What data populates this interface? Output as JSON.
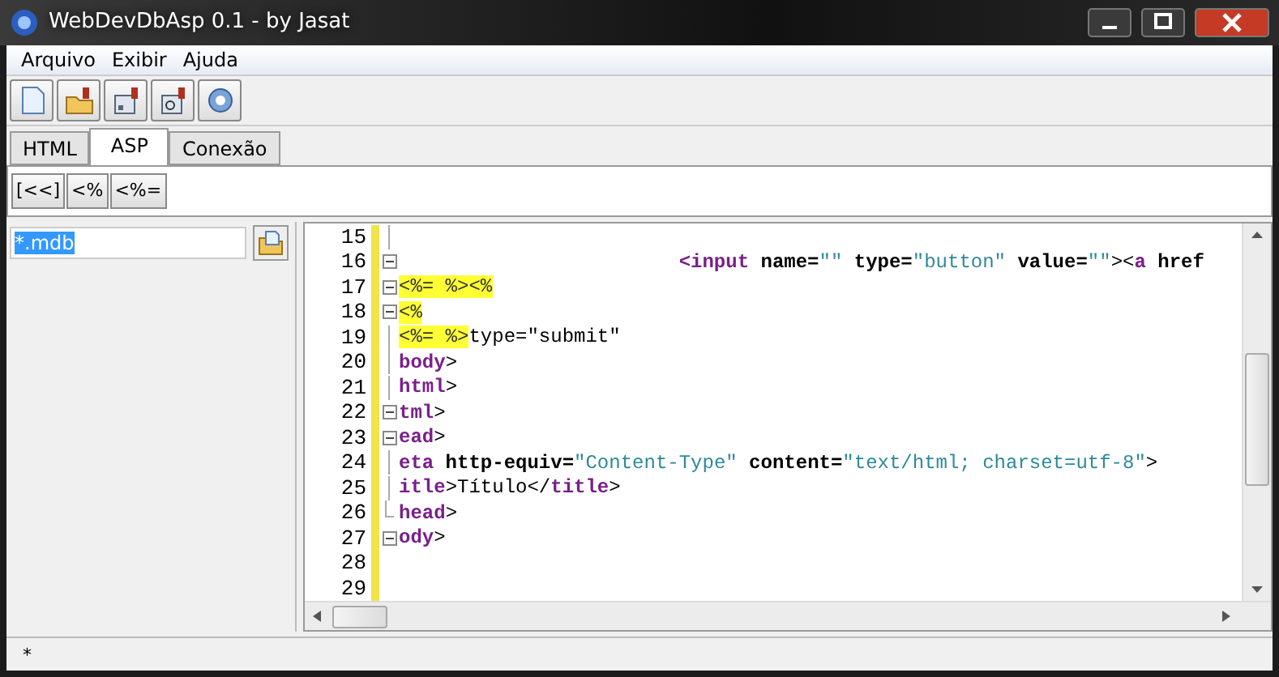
{
  "window": {
    "title": "WebDevDbAsp 0.1 - by Jasat"
  },
  "menu": [
    "Arquivo",
    "Exibir",
    "Ajuda"
  ],
  "toolbar": [
    {
      "kind": "new"
    },
    {
      "kind": "open"
    },
    {
      "kind": "save"
    },
    {
      "kind": "query"
    },
    {
      "kind": "help"
    }
  ],
  "tabs": [
    {
      "label": "HTML",
      "selected": false
    },
    {
      "label": "ASP",
      "selected": true
    },
    {
      "label": "Conexão",
      "selected": false
    }
  ],
  "snippet_buttons": [
    "[<<]",
    "<%",
    "<%="
  ],
  "file_filter": {
    "value": "*.mdb"
  },
  "editor": {
    "lines": [
      {
        "number": "15",
        "kind": "bar"
      },
      {
        "number": "16",
        "kind": "box",
        "tokens": [
          {
            "kind": "tag",
            "text": "                        <input"
          },
          {
            "kind": "attr",
            "text": " name="
          },
          {
            "kind": "str",
            "text": "\"\""
          },
          {
            "kind": "attr",
            "text": " type="
          },
          {
            "kind": "str",
            "text": "\"button\""
          },
          {
            "kind": "attr",
            "text": " value="
          },
          {
            "kind": "str",
            "text": "\"\""
          },
          {
            "kind": "text",
            "text": "><"
          },
          {
            "kind": "tag",
            "text": "a"
          },
          {
            "kind": "attr",
            "text": " href"
          }
        ]
      },
      {
        "number": "17",
        "kind": "box",
        "tokens": [
          {
            "kind": "asp",
            "text": "<%= %><%"
          }
        ]
      },
      {
        "number": "18",
        "kind": "box",
        "tokens": [
          {
            "kind": "asp",
            "text": "<%"
          }
        ]
      },
      {
        "number": "19",
        "kind": "bar",
        "tokens": [
          {
            "kind": "asp",
            "text": "<%= %>"
          },
          {
            "kind": "text",
            "text": "type=\"submit\""
          }
        ]
      },
      {
        "number": "20",
        "kind": "bar",
        "tokens": [
          {
            "kind": "tag",
            "text": "body"
          },
          {
            "kind": "text",
            "text": ">"
          }
        ]
      },
      {
        "number": "21",
        "kind": "bar",
        "tokens": [
          {
            "kind": "tag",
            "text": "html"
          },
          {
            "kind": "text",
            "text": ">"
          }
        ]
      },
      {
        "number": "22",
        "kind": "box",
        "tokens": [
          {
            "kind": "tag",
            "text": "tml"
          },
          {
            "kind": "text",
            "text": ">"
          }
        ]
      },
      {
        "number": "23",
        "kind": "box",
        "tokens": [
          {
            "kind": "tag",
            "text": "ead"
          },
          {
            "kind": "text",
            "text": ">"
          }
        ]
      },
      {
        "number": "24",
        "kind": "bar",
        "tokens": [
          {
            "kind": "tag",
            "text": "eta"
          },
          {
            "kind": "attr",
            "text": " http-equiv="
          },
          {
            "kind": "str",
            "text": "\"Content-Type\""
          },
          {
            "kind": "attr",
            "text": " content="
          },
          {
            "kind": "str",
            "text": "\"text/html; charset=utf-8\""
          },
          {
            "kind": "text",
            "text": ">"
          }
        ]
      },
      {
        "number": "25",
        "kind": "bar",
        "tokens": [
          {
            "kind": "tag",
            "text": "itle"
          },
          {
            "kind": "text",
            "text": ">Título</"
          },
          {
            "kind": "tag",
            "text": "title"
          },
          {
            "kind": "text",
            "text": ">"
          }
        ]
      },
      {
        "number": "26",
        "kind": "end",
        "tokens": [
          {
            "kind": "tag",
            "text": "head"
          },
          {
            "kind": "text",
            "text": ">"
          }
        ]
      },
      {
        "number": "27",
        "kind": "box",
        "tokens": [
          {
            "kind": "tag",
            "text": "ody"
          },
          {
            "kind": "text",
            "text": ">"
          }
        ]
      },
      {
        "number": "28",
        "kind": "plain"
      },
      {
        "number": "29",
        "kind": "plain"
      }
    ]
  },
  "status_bar": {
    "text": "*"
  }
}
